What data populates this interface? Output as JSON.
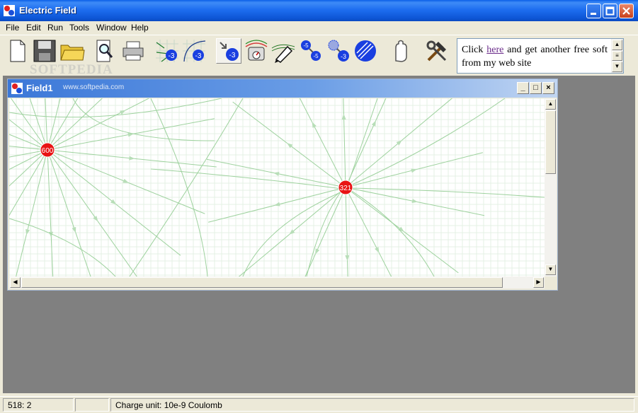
{
  "window": {
    "title": "Electric Field"
  },
  "menu": [
    "File",
    "Edit",
    "Run",
    "Tools",
    "Window",
    "Help"
  ],
  "toolbar": {
    "buttons": [
      {
        "name": "new-document-icon"
      },
      {
        "name": "save-disk-icon"
      },
      {
        "name": "open-folder-icon"
      },
      {
        "name": "print-preview-icon"
      },
      {
        "name": "printer-icon"
      },
      {
        "name": "field-lines-charge-icon",
        "label": "-3"
      },
      {
        "name": "field-curve-charge-icon",
        "label": "-3"
      },
      {
        "name": "select-charge-icon",
        "label": "-3"
      },
      {
        "name": "meter-gauge-icon"
      },
      {
        "name": "draw-pen-icon"
      },
      {
        "name": "two-charges-icon",
        "labels": [
          "-5",
          "-5"
        ]
      },
      {
        "name": "move-charge-icon",
        "label": "-3"
      },
      {
        "name": "rotate-charge-icon"
      },
      {
        "name": "hand-icon"
      },
      {
        "name": "tools-hammer-wrench-icon"
      }
    ]
  },
  "ad": {
    "prefix": "Click ",
    "link": "here",
    "suffix": " and get another free soft from my web site"
  },
  "watermark": {
    "text": "SOFTPEDIA",
    "url": "www.softpedia.com"
  },
  "child_window": {
    "title": "Field1"
  },
  "charges": [
    {
      "label": "600",
      "color": "#E81414"
    },
    {
      "label": "321",
      "color": "#E81414"
    }
  ],
  "status": {
    "coords": "518: 2",
    "middle": "",
    "charge_unit": "Charge unit: 10e-9 Coulomb"
  },
  "colors": {
    "field_line": "#9ED29E",
    "grid": "#E4F0E4",
    "charge": "#E81414"
  }
}
